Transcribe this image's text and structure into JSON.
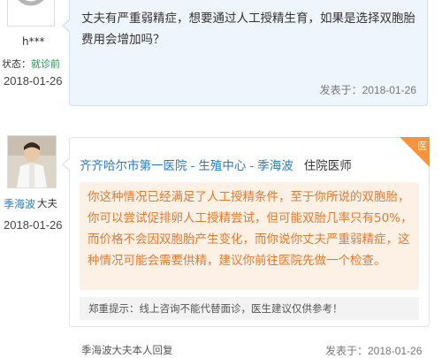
{
  "patient": {
    "name": "h***",
    "status_label": "状态：",
    "status_value": "就诊前",
    "date": "2018-01-26"
  },
  "question": {
    "text": "丈夫有严重弱精症，想要通过人工授精生育，如果是选择双胞胎费用会增加吗？",
    "posted_label": "发表于：2018-01-26"
  },
  "doctor": {
    "name": "季海波",
    "role_short": "大夫",
    "date": "2018-01-26",
    "hospital": "齐齐哈尔市第一医院",
    "department": "生殖中心",
    "doctor_link_name": "季海波",
    "title": "住院医师",
    "separator": "-",
    "badge": "医"
  },
  "answer": {
    "text": "你这种情况已经满足了人工授精条件，至于你所说的双胞胎，你可以尝试促排卵人工授精尝试，但可能双胎几率只有50%，而价格不会因双胞胎产生变化，而你说你丈夫严重弱精症，这种情况可能会需要供精，建议你前往医院先做一个检查。",
    "disclaimer": "郑重提示：线上咨询不能代替面诊，医生建议仅供参考！",
    "posted_label": "发表于：2018-01-26",
    "footer_link": "季海波大夫本人回复"
  },
  "colors": {
    "link_blue": "#2a7ac0",
    "answer_orange": "#e07b32",
    "badge_orange": "#f5943c",
    "question_bg": "#eef5fc"
  }
}
